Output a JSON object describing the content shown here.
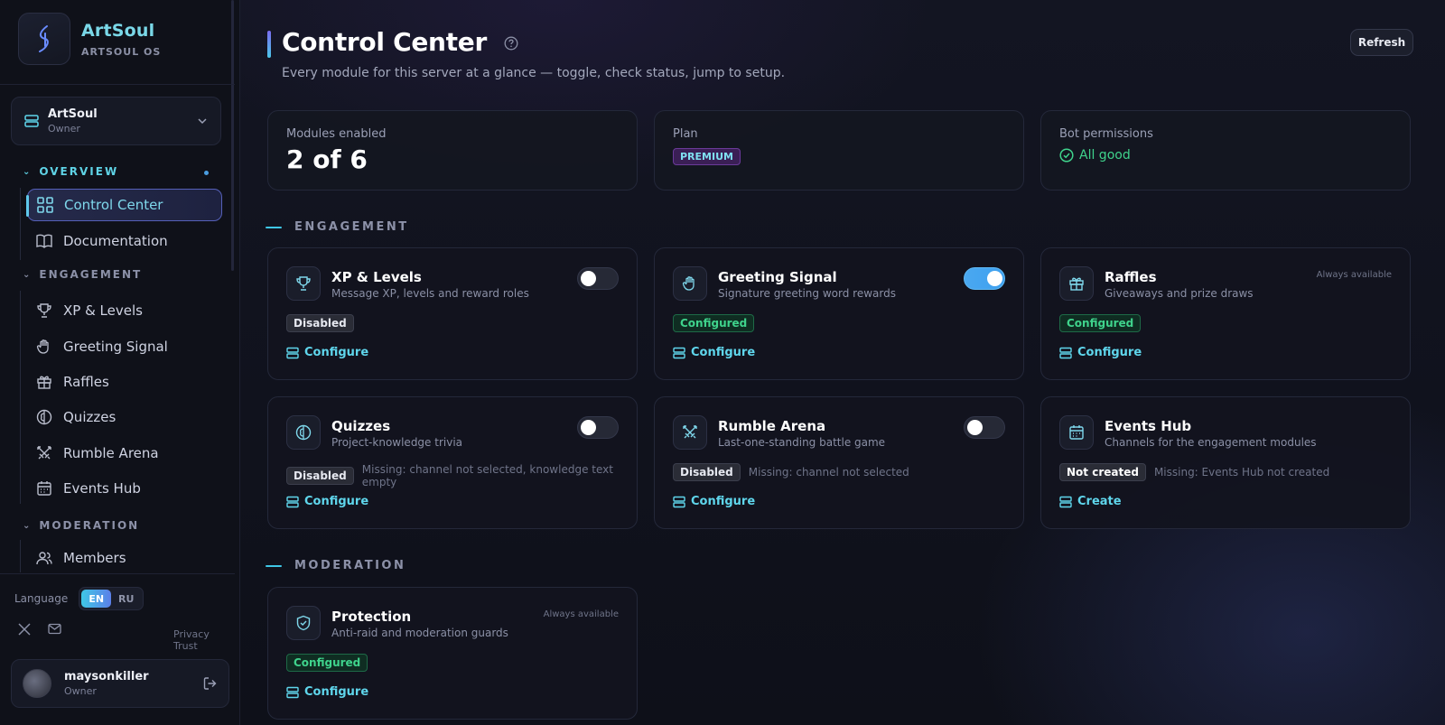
{
  "brand": {
    "name": "ArtSoul",
    "subtitle": "ARTSOUL OS"
  },
  "server": {
    "name": "ArtSoul",
    "role": "Owner"
  },
  "sidebar": {
    "overview_label": "OVERVIEW",
    "overview_items": [
      {
        "label": "Control Center",
        "icon": "grid-icon",
        "active": true
      },
      {
        "label": "Documentation",
        "icon": "book-icon"
      }
    ],
    "engagement_label": "ENGAGEMENT",
    "engagement_items": [
      {
        "label": "XP & Levels",
        "icon": "trophy-icon"
      },
      {
        "label": "Greeting Signal",
        "icon": "hand-icon"
      },
      {
        "label": "Raffles",
        "icon": "gift-icon"
      },
      {
        "label": "Quizzes",
        "icon": "brain-icon"
      },
      {
        "label": "Rumble Arena",
        "icon": "swords-icon"
      },
      {
        "label": "Events Hub",
        "icon": "calendar-icon"
      }
    ],
    "moderation_label": "MODERATION",
    "moderation_items": [
      {
        "label": "Members",
        "icon": "users-icon"
      }
    ]
  },
  "language": {
    "label": "Language",
    "options": [
      "EN",
      "RU"
    ],
    "selected": "EN"
  },
  "footer": {
    "privacy": "Privacy",
    "trust": "Trust"
  },
  "user": {
    "name": "maysonkiller",
    "role": "Owner"
  },
  "header": {
    "title": "Control Center",
    "subtitle": "Every module for this server at a glance — toggle, check status, jump to setup.",
    "refresh_label": "Refresh"
  },
  "stats": {
    "modules_label": "Modules enabled",
    "modules_value": "2 of 6",
    "plan_label": "Plan",
    "plan_value": "PREMIUM",
    "perms_label": "Bot permissions",
    "perms_value": "All good"
  },
  "groups": {
    "engagement": "ENGAGEMENT",
    "moderation": "MODERATION"
  },
  "modules": [
    {
      "title": "XP & Levels",
      "desc": "Message XP, levels and reward roles",
      "status": "Disabled",
      "missing": "",
      "action": "Configure",
      "toggle": "off"
    },
    {
      "title": "Greeting Signal",
      "desc": "Signature greeting word rewards",
      "status": "Configured",
      "missing": "",
      "action": "Configure",
      "toggle": "on"
    },
    {
      "title": "Raffles",
      "desc": "Giveaways and prize draws",
      "status": "Configured",
      "missing": "",
      "action": "Configure",
      "note": "Always available"
    },
    {
      "title": "Quizzes",
      "desc": "Project-knowledge trivia",
      "status": "Disabled",
      "missing": "Missing: channel not selected, knowledge text empty",
      "action": "Configure",
      "toggle": "off"
    },
    {
      "title": "Rumble Arena",
      "desc": "Last-one-standing battle game",
      "status": "Disabled",
      "missing": "Missing: channel not selected",
      "action": "Configure",
      "toggle": "off"
    },
    {
      "title": "Events Hub",
      "desc": "Channels for the engagement modules",
      "status": "Not created",
      "missing": "Missing: Events Hub not created",
      "action": "Create"
    },
    {
      "title": "Protection",
      "desc": "Anti-raid and moderation guards",
      "status": "Configured",
      "missing": "",
      "action": "Configure",
      "note": "Always available"
    }
  ],
  "colors": {
    "accent": "#5fd6ec",
    "success": "#3fd38c",
    "toggle_on": "#4aa8f0"
  }
}
